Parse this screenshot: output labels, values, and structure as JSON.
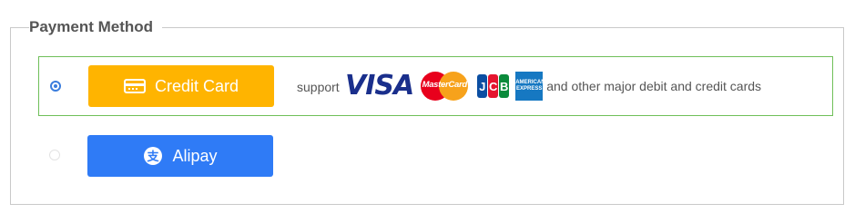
{
  "section": {
    "title": "Payment Method"
  },
  "options": [
    {
      "label": "Credit Card",
      "icon": "credit-card-icon",
      "selected": true,
      "color": "#ffb400"
    },
    {
      "label": "Alipay",
      "icon": "alipay-icon",
      "selected": false,
      "color": "#2f7bf6"
    }
  ],
  "support": {
    "prefix": "support",
    "logos": [
      "VISA",
      "MasterCard",
      "JCB",
      "AMERICAN EXPRESS"
    ],
    "suffix": "and other major debit and credit cards"
  },
  "colors": {
    "selected_border": "#6fbf59",
    "radio_active": "#3b7ddd"
  }
}
